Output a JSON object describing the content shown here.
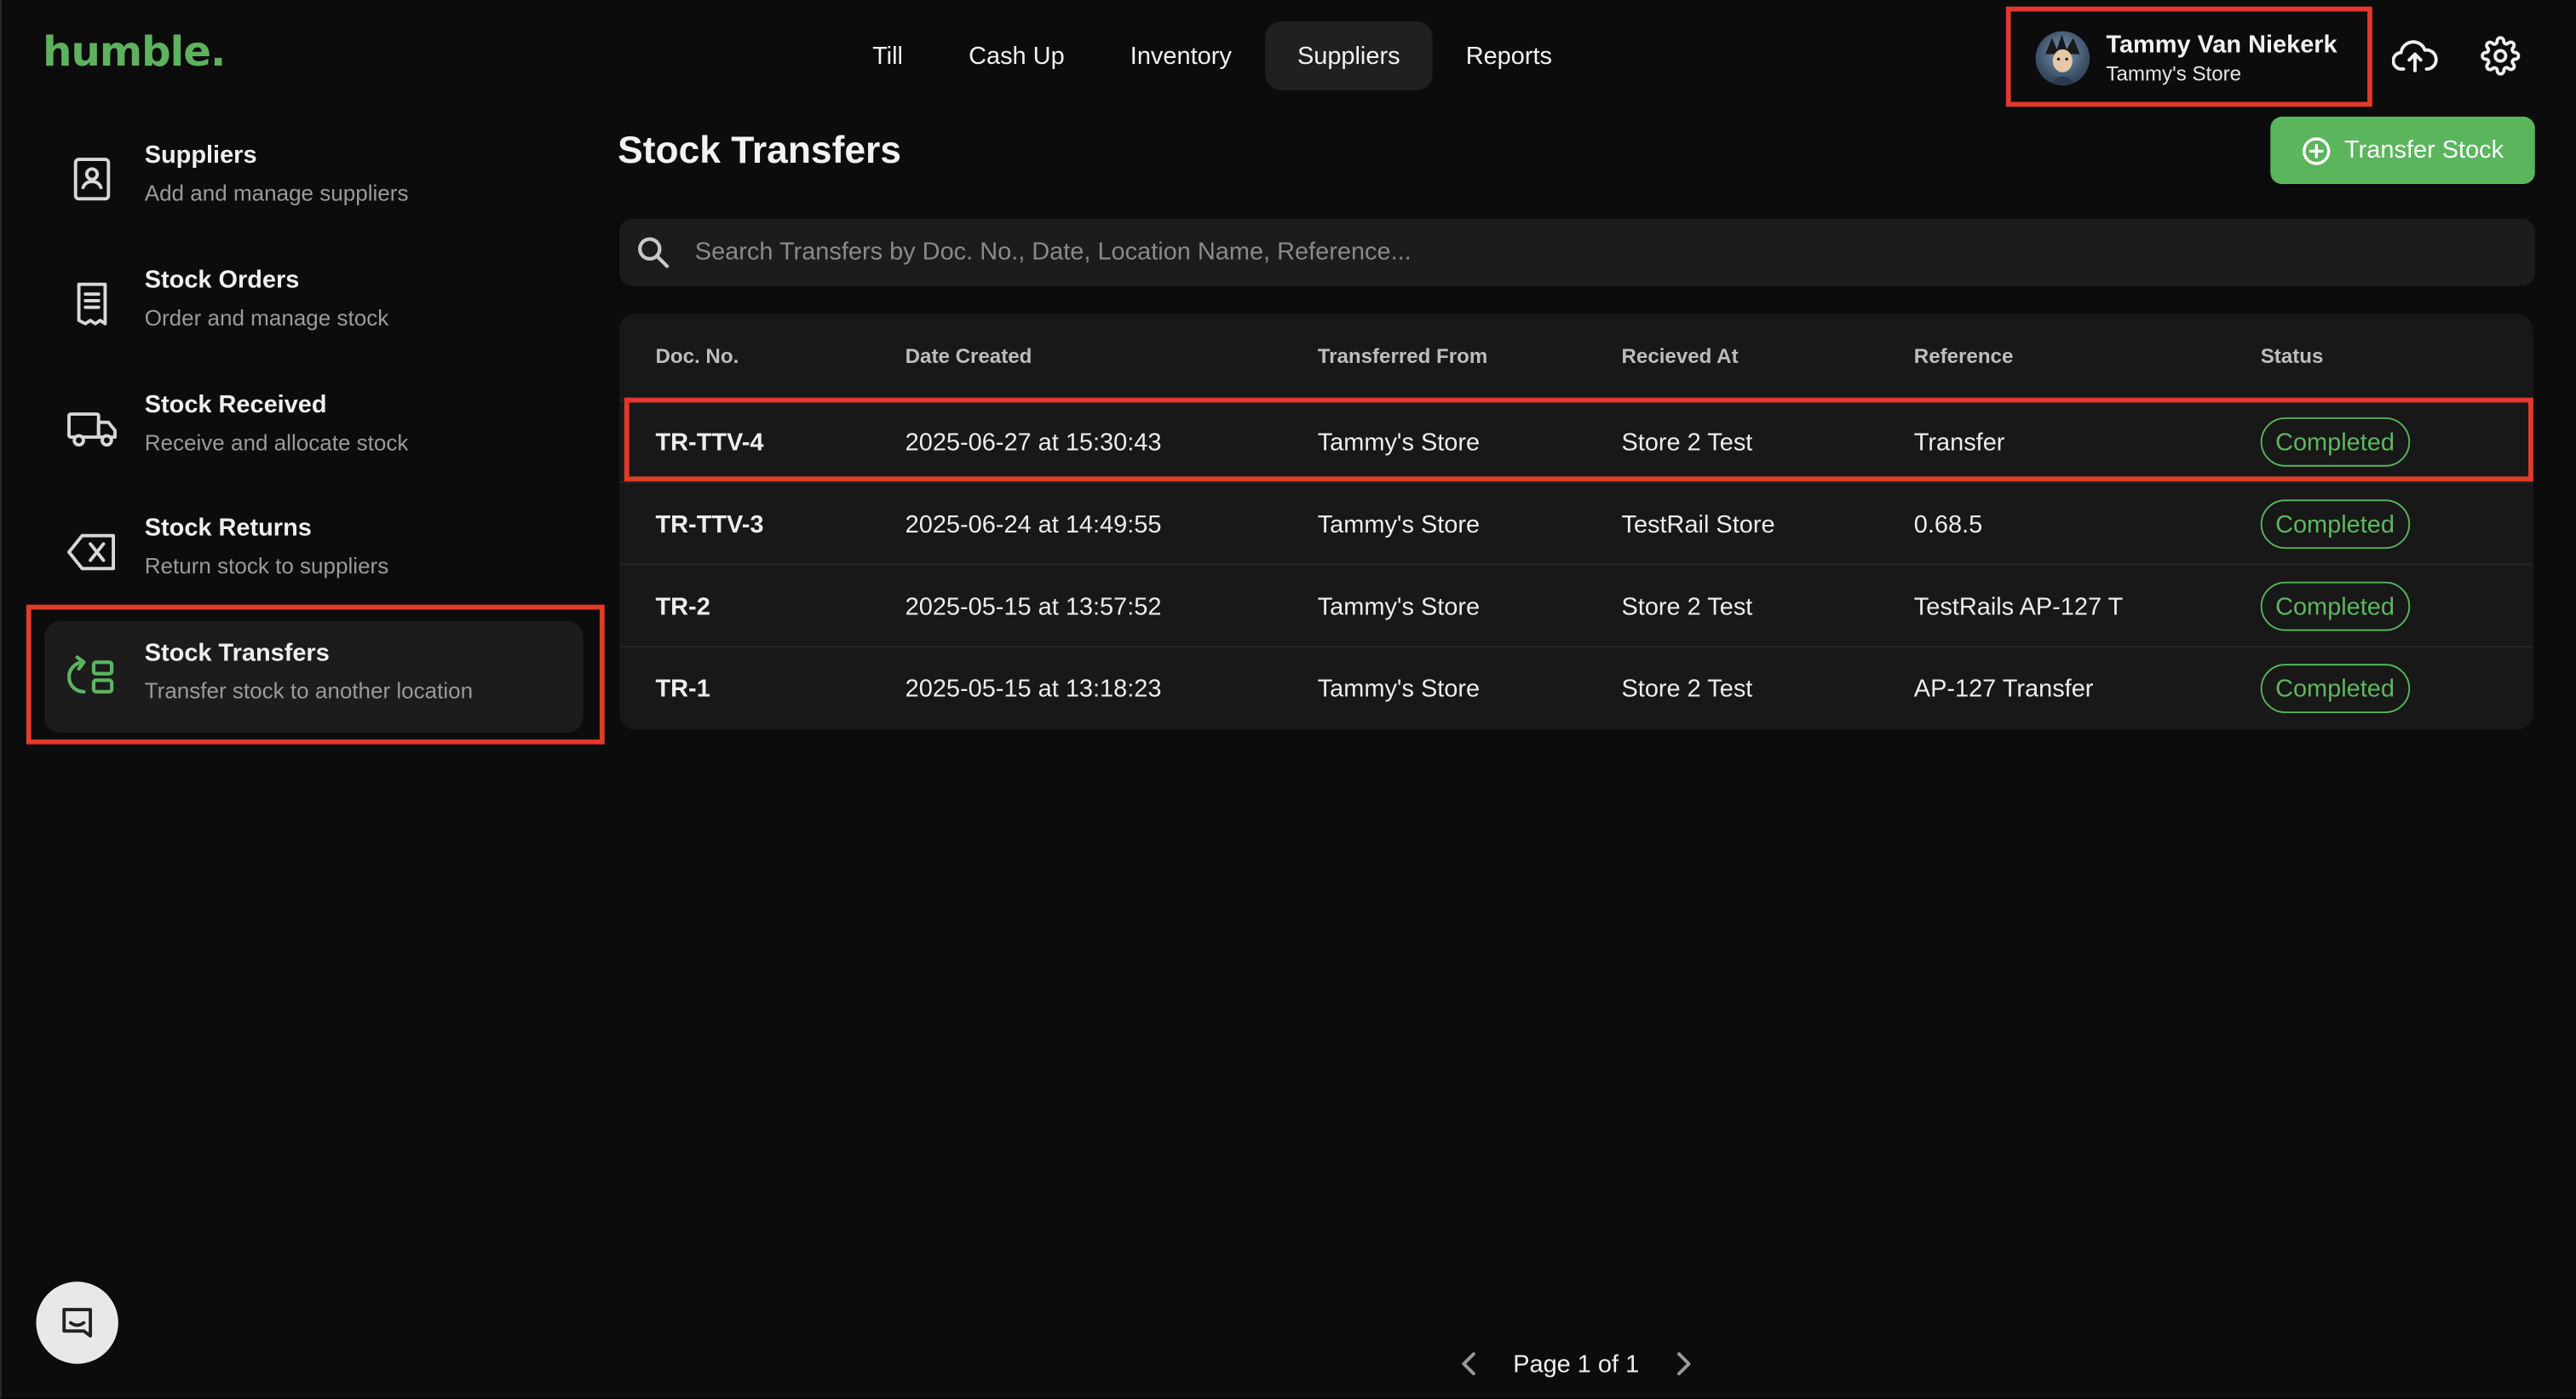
{
  "app": {
    "logo": "humble."
  },
  "topnav": {
    "tabs": [
      {
        "label": "Till",
        "active": false
      },
      {
        "label": "Cash Up",
        "active": false
      },
      {
        "label": "Inventory",
        "active": false
      },
      {
        "label": "Suppliers",
        "active": true
      },
      {
        "label": "Reports",
        "active": false
      }
    ]
  },
  "user": {
    "name": "Tammy Van Niekerk",
    "store": "Tammy's Store"
  },
  "icons": {
    "sync": "cloud-upload-icon",
    "settings": "gear-icon"
  },
  "sidebar": {
    "items": [
      {
        "title": "Suppliers",
        "subtitle": "Add and manage suppliers",
        "icon": "supplier-contact-icon",
        "active": false
      },
      {
        "title": "Stock Orders",
        "subtitle": "Order and manage stock",
        "icon": "receipt-icon",
        "active": false
      },
      {
        "title": "Stock Received",
        "subtitle": "Receive and allocate stock",
        "icon": "truck-icon",
        "active": false
      },
      {
        "title": "Stock Returns",
        "subtitle": "Return stock to suppliers",
        "icon": "backspace-x-icon",
        "active": false
      },
      {
        "title": "Stock Transfers",
        "subtitle": "Transfer stock to another location",
        "icon": "transfer-icon",
        "active": true
      }
    ]
  },
  "main": {
    "title": "Stock Transfers",
    "action_label": "Transfer Stock",
    "search_placeholder": "Search Transfers by Doc. No., Date, Location Name, Reference...",
    "columns": [
      "Doc. No.",
      "Date Created",
      "Transferred From",
      "Recieved At",
      "Reference",
      "Status"
    ],
    "rows": [
      {
        "doc": "TR-TTV-4",
        "date": "2025-06-27 at 15:30:43",
        "from": "Tammy's Store",
        "to": "Store 2 Test",
        "reference": "Transfer",
        "status": "Completed"
      },
      {
        "doc": "TR-TTV-3",
        "date": "2025-06-24 at 14:49:55",
        "from": "Tammy's Store",
        "to": "TestRail Store",
        "reference": "0.68.5",
        "status": "Completed"
      },
      {
        "doc": "TR-2",
        "date": "2025-05-15 at 13:57:52",
        "from": "Tammy's Store",
        "to": "Store 2 Test",
        "reference": "TestRails AP-127 T",
        "status": "Completed"
      },
      {
        "doc": "TR-1",
        "date": "2025-05-15 at 13:18:23",
        "from": "Tammy's Store",
        "to": "Store 2 Test",
        "reference": "AP-127 Transfer",
        "status": "Completed"
      }
    ]
  },
  "pagination": {
    "label": "Page 1 of 1"
  },
  "colors": {
    "accent": "#5bb55d",
    "highlight": "#e23a2b",
    "background": "#0c0c0c",
    "surface": "#181818"
  }
}
